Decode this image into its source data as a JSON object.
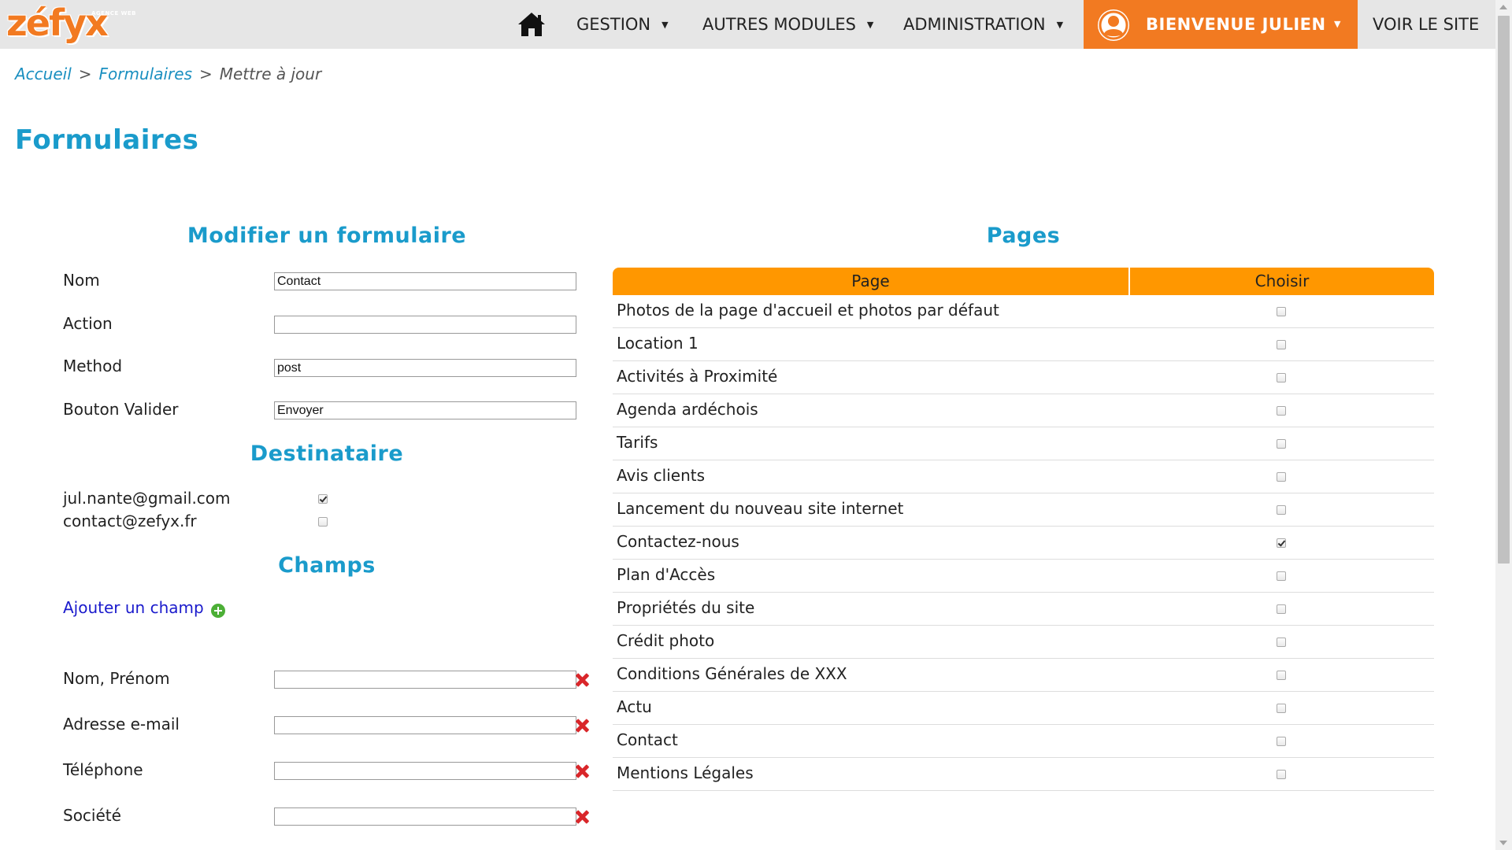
{
  "brand": {
    "logo_word": "zéfyx",
    "logo_sub": "AGENCE WEB",
    "accent": "#f27a21",
    "title_color": "#1a9bcb",
    "header_orange": "#ff9700"
  },
  "nav": {
    "home_icon": "home-icon",
    "items": [
      "GESTION",
      "AUTRES MODULES",
      "ADMINISTRATION"
    ],
    "user_label": "BIENVENUE JULIEN",
    "site_label": "VOIR LE SITE"
  },
  "breadcrumb": {
    "home": "Accueil",
    "forms": "Formulaires",
    "current": "Mettre à jour",
    "sep": ">"
  },
  "page_title": "Formulaires",
  "edit_form": {
    "title": "Modifier un formulaire",
    "fields": [
      {
        "label": "Nom",
        "value": "Contact"
      },
      {
        "label": "Action",
        "value": ""
      },
      {
        "label": "Method",
        "value": "post"
      },
      {
        "label": "Bouton Valider",
        "value": "Envoyer"
      }
    ]
  },
  "recipients": {
    "title": "Destinataire",
    "items": [
      {
        "email": "jul.nante@gmail.com",
        "checked": true
      },
      {
        "email": "contact@zefyx.fr",
        "checked": false
      }
    ]
  },
  "fields_section": {
    "title": "Champs",
    "add_label": "Ajouter un champ",
    "items": [
      {
        "label": "Nom, Prénom",
        "value": ""
      },
      {
        "label": "Adresse e-mail",
        "value": ""
      },
      {
        "label": "Téléphone",
        "value": ""
      },
      {
        "label": "Société",
        "value": ""
      }
    ]
  },
  "pages": {
    "title": "Pages",
    "col_page": "Page",
    "col_choose": "Choisir",
    "rows": [
      {
        "name": "Photos de la page d'accueil et photos par défaut",
        "checked": false
      },
      {
        "name": "Location 1",
        "checked": false
      },
      {
        "name": "Activités à Proximité",
        "checked": false
      },
      {
        "name": "Agenda ardéchois",
        "checked": false
      },
      {
        "name": "Tarifs",
        "checked": false
      },
      {
        "name": "Avis clients",
        "checked": false
      },
      {
        "name": "Lancement du nouveau site internet",
        "checked": false
      },
      {
        "name": "Contactez-nous",
        "checked": true
      },
      {
        "name": "Plan d'Accès",
        "checked": false
      },
      {
        "name": "Propriétés du site",
        "checked": false
      },
      {
        "name": "Crédit photo",
        "checked": false
      },
      {
        "name": "Conditions Générales de XXX",
        "checked": false
      },
      {
        "name": "Actu",
        "checked": false
      },
      {
        "name": "Contact",
        "checked": false
      },
      {
        "name": "Mentions Légales",
        "checked": false
      }
    ]
  }
}
